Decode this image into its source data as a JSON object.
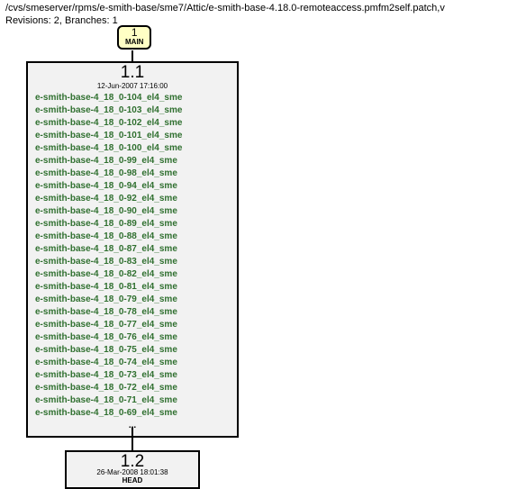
{
  "header": {
    "path": "/cvs/smeserver/rpms/e-smith-base/sme7/Attic/e-smith-base-4.18.0-remoteaccess.pmfm2self.patch,v",
    "revisions_line": "Revisions: 2, Branches: 1"
  },
  "branch": {
    "num": "1",
    "name": "MAIN"
  },
  "rev_big": {
    "title": "1.1",
    "date": "12-Jun-2007 17:16:00",
    "tags": [
      "e-smith-base-4_18_0-104_el4_sme",
      "e-smith-base-4_18_0-103_el4_sme",
      "e-smith-base-4_18_0-102_el4_sme",
      "e-smith-base-4_18_0-101_el4_sme",
      "e-smith-base-4_18_0-100_el4_sme",
      "e-smith-base-4_18_0-99_el4_sme",
      "e-smith-base-4_18_0-98_el4_sme",
      "e-smith-base-4_18_0-94_el4_sme",
      "e-smith-base-4_18_0-92_el4_sme",
      "e-smith-base-4_18_0-90_el4_sme",
      "e-smith-base-4_18_0-89_el4_sme",
      "e-smith-base-4_18_0-88_el4_sme",
      "e-smith-base-4_18_0-87_el4_sme",
      "e-smith-base-4_18_0-83_el4_sme",
      "e-smith-base-4_18_0-82_el4_sme",
      "e-smith-base-4_18_0-81_el4_sme",
      "e-smith-base-4_18_0-79_el4_sme",
      "e-smith-base-4_18_0-78_el4_sme",
      "e-smith-base-4_18_0-77_el4_sme",
      "e-smith-base-4_18_0-76_el4_sme",
      "e-smith-base-4_18_0-75_el4_sme",
      "e-smith-base-4_18_0-74_el4_sme",
      "e-smith-base-4_18_0-73_el4_sme",
      "e-smith-base-4_18_0-72_el4_sme",
      "e-smith-base-4_18_0-71_el4_sme",
      "e-smith-base-4_18_0-69_el4_sme"
    ],
    "ellipsis": "..."
  },
  "rev_small": {
    "title": "1.2",
    "date": "26-Mar-2008 18:01:38",
    "head": "HEAD"
  }
}
